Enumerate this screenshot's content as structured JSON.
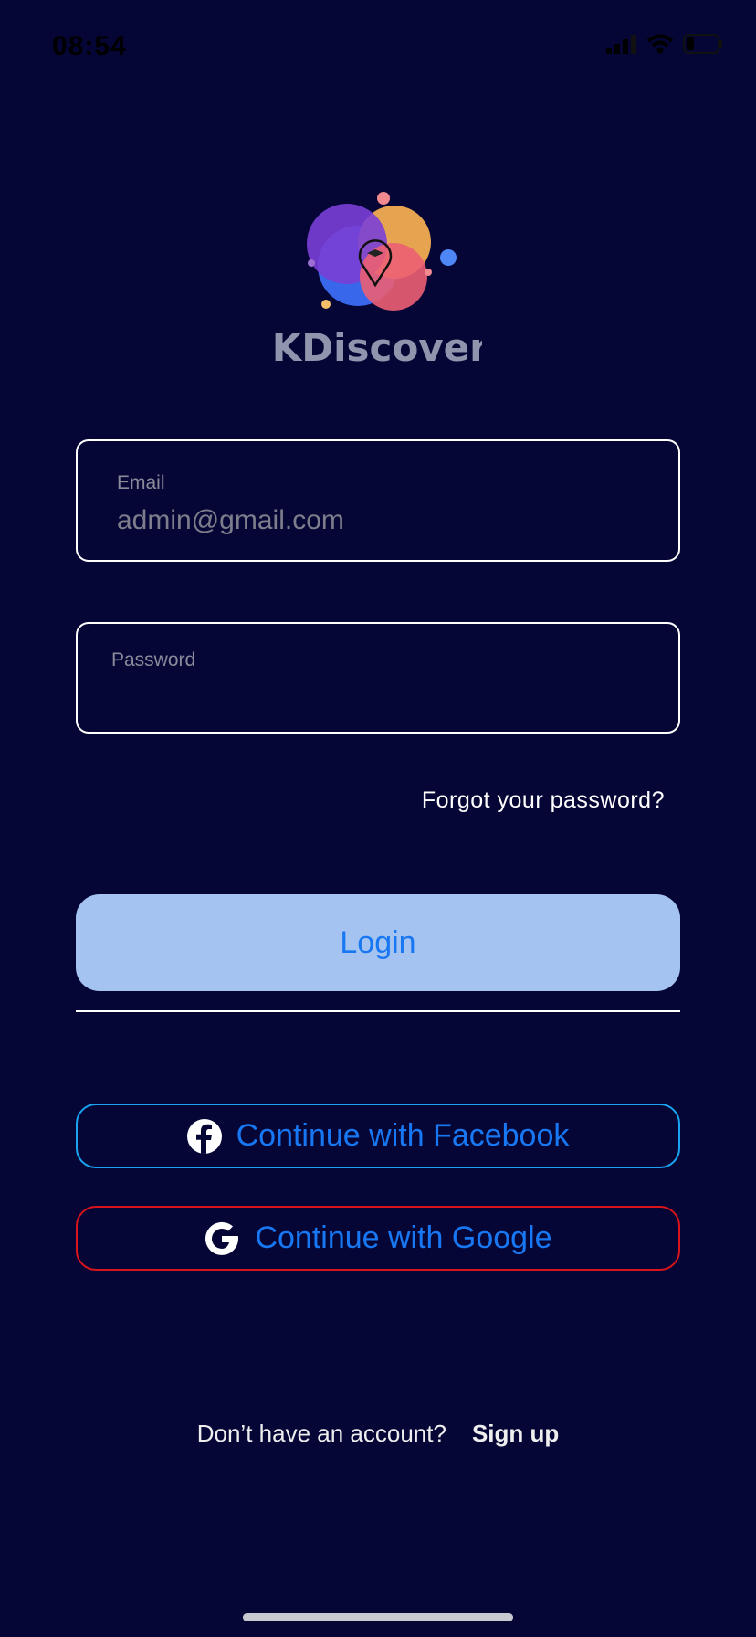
{
  "status_bar": {
    "time": "08:54",
    "icons": [
      "signal-icon",
      "wifi-icon",
      "battery-icon"
    ]
  },
  "logo": {
    "text": "BKDiscovery"
  },
  "form": {
    "email": {
      "label": "Email",
      "value": "admin@gmail.com"
    },
    "password": {
      "label": "Password",
      "value": ""
    },
    "forgot_label": "Forgot your password?",
    "login_label": "Login"
  },
  "social": {
    "facebook_label": "Continue with Facebook",
    "google_label": "Continue with Google"
  },
  "footer": {
    "prompt": "Don’t have an account?",
    "signup_label": "Sign up"
  },
  "colors": {
    "background": "#050636",
    "accent": "#1877f2",
    "login_bg": "#a4c3f1",
    "facebook_border": "#1aa3f0",
    "google_border": "#d8141c"
  }
}
